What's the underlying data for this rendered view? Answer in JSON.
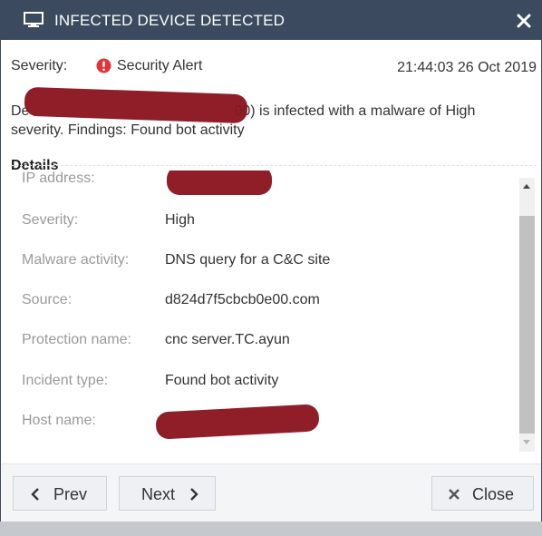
{
  "dialog": {
    "title": "INFECTED DEVICE DETECTED",
    "title_icon": "monitor-icon",
    "close_icon": "close-icon"
  },
  "severity": {
    "label": "Severity:",
    "icon": "alert-circle-icon",
    "value": "Security Alert",
    "timestamp": "21:44:03 26 Oct 2019"
  },
  "description": {
    "start": "De",
    "end": "00) is infected with a malware of High severity. Findings: Found bot activity"
  },
  "details": {
    "heading": "Details",
    "rows": [
      {
        "key": "IP address:",
        "value": ""
      },
      {
        "key": "Severity:",
        "value": "High"
      },
      {
        "key": "Malware activity:",
        "value": "DNS query for a C&C site"
      },
      {
        "key": "Source:",
        "value": "d824d7f5cbcb0e00.com"
      },
      {
        "key": "Protection name:",
        "value": "cnc server.TC.ayun"
      },
      {
        "key": "Incident type:",
        "value": "Found bot activity"
      },
      {
        "key": "Host name:",
        "value": ""
      }
    ]
  },
  "footer": {
    "prev_label": "Prev",
    "next_label": "Next",
    "close_label": "Close"
  },
  "colors": {
    "title_bar": "#3b4a5e",
    "alert_red": "#e0353a",
    "redaction": "#8a1520"
  }
}
